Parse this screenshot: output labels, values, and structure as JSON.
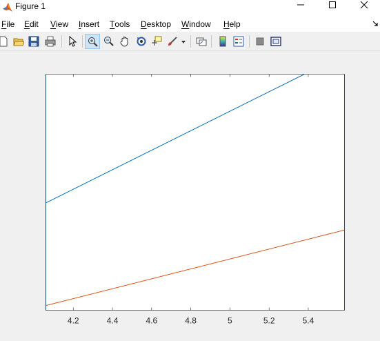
{
  "window": {
    "title": "Figure 1",
    "minimize_icon": "minimize-icon",
    "maximize_icon": "maximize-icon",
    "close_icon": "close-icon"
  },
  "menu": {
    "items": [
      {
        "key": "F",
        "rest": "ile"
      },
      {
        "key": "E",
        "rest": "dit"
      },
      {
        "key": "V",
        "rest": "iew"
      },
      {
        "key": "I",
        "rest": "nsert"
      },
      {
        "key": "T",
        "rest": "ools"
      },
      {
        "key": "D",
        "rest": "esktop"
      },
      {
        "key": "W",
        "rest": "indow"
      },
      {
        "key": "H",
        "rest": "elp"
      }
    ]
  },
  "toolbar": {
    "buttons": [
      "new-figure-icon",
      "open-icon",
      "save-icon",
      "print-icon",
      "edit-pointer-icon",
      "zoom-in-icon",
      "zoom-out-icon",
      "pan-icon",
      "rotate-3d-icon",
      "data-cursor-icon",
      "brush-icon",
      "link-plot-icon",
      "colorbar-icon",
      "legend-icon",
      "hide-plot-tools-icon",
      "show-plot-tools-icon"
    ],
    "active": "zoom-in-icon"
  },
  "colors": {
    "series1": "#0072bd",
    "series2": "#d95319",
    "axes_bg": "#ffffff",
    "figure_bg": "#f0f0f0"
  },
  "chart_data": {
    "type": "line",
    "title": "",
    "xlabel": "",
    "ylabel": "",
    "xlim": [
      4.06,
      5.585
    ],
    "ylim": [
      0,
      1
    ],
    "xticks": [
      "4.2",
      "4.4",
      "4.6",
      "4.8",
      "5",
      "5.2",
      "5.4"
    ],
    "xtick_values": [
      4.2,
      4.4,
      4.6,
      4.8,
      5.0,
      5.2,
      5.4
    ],
    "grid": false,
    "series": [
      {
        "x": [
          4.06,
          5.38
        ],
        "y": [
          0.455,
          1.0
        ]
      },
      {
        "x": [
          4.06,
          5.585
        ],
        "y": [
          0.02,
          0.34
        ]
      }
    ]
  }
}
